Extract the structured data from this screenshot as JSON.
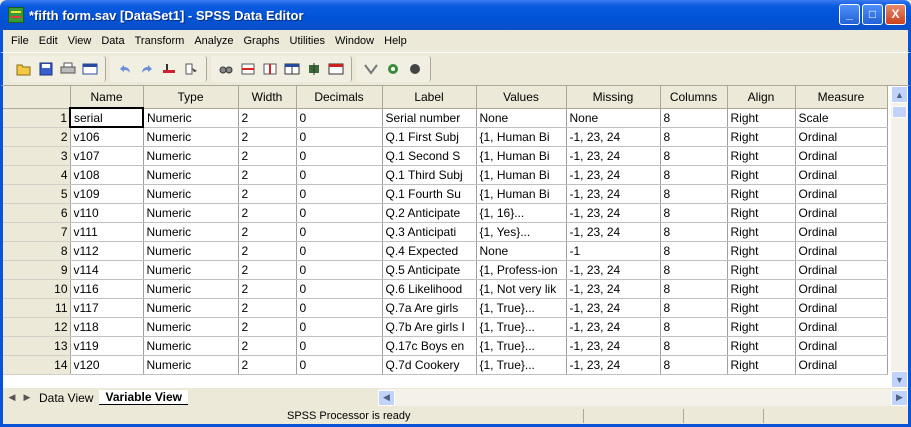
{
  "window": {
    "title": "*fifth form.sav [DataSet1] - SPSS Data Editor",
    "buttons": {
      "minimize": "_",
      "maximize": "□",
      "close": "X"
    }
  },
  "menu": [
    "File",
    "Edit",
    "View",
    "Data",
    "Transform",
    "Analyze",
    "Graphs",
    "Utilities",
    "Window",
    "Help"
  ],
  "toolbar": {
    "icons": [
      "open-icon",
      "save-icon",
      "print-icon",
      "dialog-recall-icon",
      "undo-icon",
      "redo-icon",
      "goto-case-icon",
      "variables-icon",
      "find-icon",
      "insert-cases-icon",
      "insert-variable-icon",
      "split-file-icon",
      "weight-cases-icon",
      "select-cases-icon",
      "value-labels-icon",
      "use-sets-icon",
      "show-all-icon"
    ]
  },
  "grid": {
    "columns": [
      "Name",
      "Type",
      "Width",
      "Decimals",
      "Label",
      "Values",
      "Missing",
      "Columns",
      "Align",
      "Measure"
    ],
    "rows": [
      {
        "num": "1",
        "name": "serial",
        "type": "Numeric",
        "width": "2",
        "decimals": "0",
        "label": "Serial number",
        "values": "None",
        "missing": "None",
        "columns": "8",
        "align": "Right",
        "measure": "Scale"
      },
      {
        "num": "2",
        "name": "v106",
        "type": "Numeric",
        "width": "2",
        "decimals": "0",
        "label": "Q.1  First Subj",
        "values": "{1, Human   Bi",
        "missing": "-1, 23, 24",
        "columns": "8",
        "align": "Right",
        "measure": "Ordinal"
      },
      {
        "num": "3",
        "name": "v107",
        "type": "Numeric",
        "width": "2",
        "decimals": "0",
        "label": "Q.1  Second S",
        "values": "{1, Human   Bi",
        "missing": "-1, 23, 24",
        "columns": "8",
        "align": "Right",
        "measure": "Ordinal"
      },
      {
        "num": "4",
        "name": "v108",
        "type": "Numeric",
        "width": "2",
        "decimals": "0",
        "label": "Q.1  Third Subj",
        "values": "{1, Human   Bi",
        "missing": "-1, 23, 24",
        "columns": "8",
        "align": "Right",
        "measure": "Ordinal"
      },
      {
        "num": "5",
        "name": "v109",
        "type": "Numeric",
        "width": "2",
        "decimals": "0",
        "label": "Q.1  Fourth Su",
        "values": "{1, Human   Bi",
        "missing": "-1, 23, 24",
        "columns": "8",
        "align": "Right",
        "measure": "Ordinal"
      },
      {
        "num": "6",
        "name": "v110",
        "type": "Numeric",
        "width": "2",
        "decimals": "0",
        "label": "Q.2  Anticipate",
        "values": "{1, 16}...",
        "missing": "-1, 23, 24",
        "columns": "8",
        "align": "Right",
        "measure": "Ordinal"
      },
      {
        "num": "7",
        "name": "v111",
        "type": "Numeric",
        "width": "2",
        "decimals": "0",
        "label": "Q.3  Anticipati",
        "values": "{1, Yes}...",
        "missing": "-1, 23, 24",
        "columns": "8",
        "align": "Right",
        "measure": "Ordinal"
      },
      {
        "num": "8",
        "name": "v112",
        "type": "Numeric",
        "width": "2",
        "decimals": "0",
        "label": "Q.4  Expected",
        "values": "None",
        "missing": "-1",
        "columns": "8",
        "align": "Right",
        "measure": "Ordinal"
      },
      {
        "num": "9",
        "name": "v114",
        "type": "Numeric",
        "width": "2",
        "decimals": "0",
        "label": "Q.5  Anticipate",
        "values": "{1, Profess-ion",
        "missing": "-1, 23, 24",
        "columns": "8",
        "align": "Right",
        "measure": "Ordinal"
      },
      {
        "num": "10",
        "name": "v116",
        "type": "Numeric",
        "width": "2",
        "decimals": "0",
        "label": "Q.6  Likelihood",
        "values": "{1, Not very lik",
        "missing": "-1, 23, 24",
        "columns": "8",
        "align": "Right",
        "measure": "Ordinal"
      },
      {
        "num": "11",
        "name": "v117",
        "type": "Numeric",
        "width": "2",
        "decimals": "0",
        "label": "Q.7a Are girls",
        "values": "{1, True}...",
        "missing": "-1, 23, 24",
        "columns": "8",
        "align": "Right",
        "measure": "Ordinal"
      },
      {
        "num": "12",
        "name": "v118",
        "type": "Numeric",
        "width": "2",
        "decimals": "0",
        "label": "Q.7b Are girls I",
        "values": "{1, True}...",
        "missing": "-1, 23, 24",
        "columns": "8",
        "align": "Right",
        "measure": "Ordinal"
      },
      {
        "num": "13",
        "name": "v119",
        "type": "Numeric",
        "width": "2",
        "decimals": "0",
        "label": "Q.17c Boys en",
        "values": "{1, True}...",
        "missing": "-1, 23, 24",
        "columns": "8",
        "align": "Right",
        "measure": "Ordinal"
      },
      {
        "num": "14",
        "name": "v120",
        "type": "Numeric",
        "width": "2",
        "decimals": "0",
        "label": "Q.7d Cookery",
        "values": "{1, True}...",
        "missing": "-1, 23, 24",
        "columns": "8",
        "align": "Right",
        "measure": "Ordinal"
      }
    ]
  },
  "tabs": {
    "data_view": "Data View",
    "variable_view": "Variable View"
  },
  "status": {
    "text": "SPSS Processor  is ready"
  }
}
